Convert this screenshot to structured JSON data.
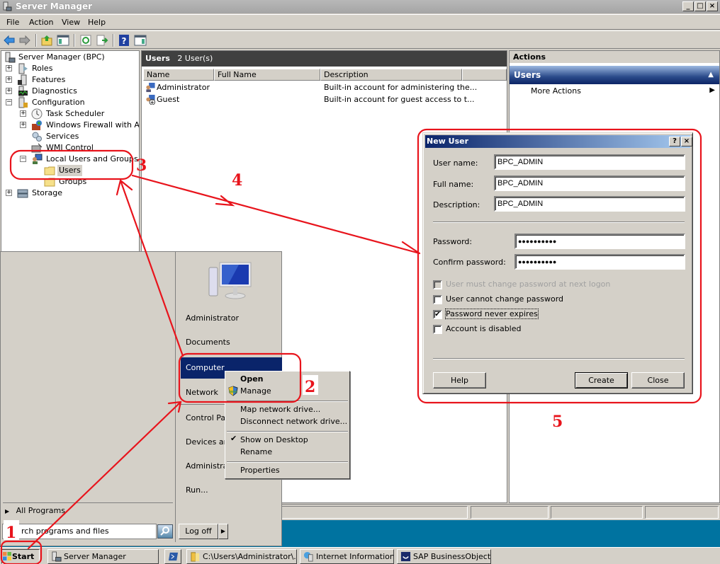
{
  "window": {
    "title": "Server Manager",
    "controls": [
      "_",
      "□",
      "×"
    ]
  },
  "menu": [
    "File",
    "Action",
    "View",
    "Help"
  ],
  "toolbar": {
    "icons": [
      "back-icon",
      "forward-icon",
      "up-icon",
      "show-hide-tree-icon",
      "refresh-icon",
      "export-icon",
      "help-icon",
      "show-hide-action-icon"
    ]
  },
  "tree": {
    "root": "Server Manager (BPC)",
    "items": [
      {
        "label": "Roles",
        "expander": "+"
      },
      {
        "label": "Features",
        "expander": "+"
      },
      {
        "label": "Diagnostics",
        "expander": "+"
      },
      {
        "label": "Configuration",
        "expander": "−"
      },
      {
        "label": "Task Scheduler",
        "expander": "+"
      },
      {
        "label": "Windows Firewall with Adva",
        "expander": "+"
      },
      {
        "label": "Services",
        "expander": ""
      },
      {
        "label": "WMI Control",
        "expander": ""
      },
      {
        "label": "Local Users and Groups",
        "expander": "−"
      },
      {
        "label": "Users",
        "expander": ""
      },
      {
        "label": "Groups",
        "expander": ""
      },
      {
        "label": "Storage",
        "expander": "+"
      }
    ]
  },
  "users_pane": {
    "title": "Users",
    "count": "2 User(s)",
    "columns": [
      "Name",
      "Full Name",
      "Description"
    ],
    "rows": [
      {
        "name": "Administrator",
        "full_name": "",
        "description": "Built-in account for administering the..."
      },
      {
        "name": "Guest",
        "full_name": "",
        "description": "Built-in account for guest access to t..."
      }
    ]
  },
  "actions": {
    "header": "Actions",
    "section": "Users",
    "items": [
      "More Actions"
    ]
  },
  "start_menu": {
    "user_items": [
      "Administrator",
      "Documents",
      "Computer",
      "Network",
      "Control Pan",
      "Devices and",
      "Administrati",
      "Run..."
    ],
    "all_programs": "All Programs",
    "search_value": "rch programs and files",
    "logoff": "Log off"
  },
  "context_menu": {
    "items": [
      "Open",
      "Manage",
      "Map network drive...",
      "Disconnect network drive...",
      "Show on Desktop",
      "Rename",
      "Properties"
    ],
    "checked": "Show on Desktop"
  },
  "dialog": {
    "title": "New User",
    "fields": {
      "user_name_label": "User name:",
      "user_name": "BPC_ADMIN",
      "full_name_label": "Full name:",
      "full_name": "BPC_ADMIN",
      "description_label": "Description:",
      "description": "BPC_ADMIN",
      "password_label": "Password:",
      "password": "●●●●●●●●●●",
      "confirm_label": "Confirm password:",
      "confirm": "●●●●●●●●●●"
    },
    "checkboxes": [
      {
        "label": "User must change password at next logon",
        "checked": false,
        "disabled": true
      },
      {
        "label": "User cannot change password",
        "checked": false,
        "disabled": false
      },
      {
        "label": "Password never expires",
        "checked": true,
        "disabled": false
      },
      {
        "label": "Account is disabled",
        "checked": false,
        "disabled": false
      }
    ],
    "buttons": {
      "help": "Help",
      "create": "Create",
      "close": "Close"
    }
  },
  "taskbar": {
    "start": "Start",
    "items": [
      "Server Manager",
      "C:\\Users\\Administrator\\...",
      "Internet Information Ser...",
      "SAP BusinessObjects"
    ]
  },
  "annotations": {
    "colors": {
      "red": "#e8141c"
    },
    "labels": [
      "1",
      "2",
      "3",
      "4",
      "5"
    ]
  }
}
